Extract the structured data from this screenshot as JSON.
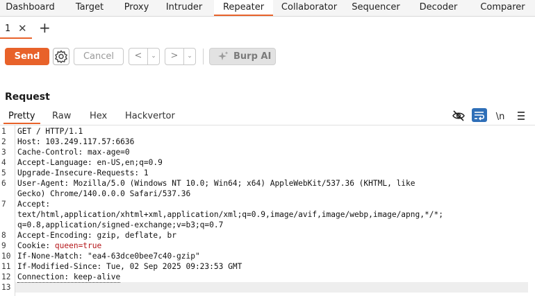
{
  "tool_tabs": [
    "Dashboard",
    "Target",
    "Proxy",
    "Intruder",
    "Repeater",
    "Collaborator",
    "Sequencer",
    "Decoder",
    "Comparer"
  ],
  "active_tool_tab": "Repeater",
  "sub_tab": {
    "label": "1",
    "close": "✕",
    "add": "+"
  },
  "toolbar": {
    "send": "Send",
    "cancel": "Cancel",
    "back": "<",
    "forward": ">",
    "dropdown": "⌄",
    "burp_ai": "Burp AI"
  },
  "request": {
    "title": "Request",
    "view_tabs": [
      "Pretty",
      "Raw",
      "Hex",
      "Hackvertor"
    ],
    "active_view": "Pretty",
    "newline_toggle": "\\n"
  },
  "colors": {
    "accent": "#e8622a",
    "wrap_icon_bg": "#2f6fb8",
    "cookie_value": "#b5161a"
  },
  "editor_lines": [
    {
      "n": "1",
      "text": "GET / HTTP/1.1"
    },
    {
      "n": "2",
      "text": "Host: 103.249.117.57:6636"
    },
    {
      "n": "3",
      "text": "Cache-Control: max-age=0"
    },
    {
      "n": "4",
      "text": "Accept-Language: en-US,en;q=0.9"
    },
    {
      "n": "5",
      "text": "Upgrade-Insecure-Requests: 1"
    },
    {
      "n": "6",
      "text": "User-Agent: Mozilla/5.0 (Windows NT 10.0; Win64; x64) AppleWebKit/537.36 (KHTML, like"
    },
    {
      "n": "",
      "text": "Gecko) Chrome/140.0.0.0 Safari/537.36"
    },
    {
      "n": "7",
      "text": "Accept:"
    },
    {
      "n": "",
      "text": "text/html,application/xhtml+xml,application/xml;q=0.9,image/avif,image/webp,image/apng,*/*;"
    },
    {
      "n": "",
      "text": "q=0.8,application/signed-exchange;v=b3;q=0.7"
    },
    {
      "n": "8",
      "text": "Accept-Encoding: gzip, deflate, br"
    },
    {
      "n": "9",
      "text": "Cookie: ",
      "cookie_value": "queen=true"
    },
    {
      "n": "10",
      "text": "If-None-Match: \"ea4-63dce0bee7c40-gzip\""
    },
    {
      "n": "11",
      "text": "If-Modified-Since: Tue, 02 Sep 2025 09:23:53 GMT"
    },
    {
      "n": "12",
      "text": "Connection: keep-alive"
    },
    {
      "n": "13",
      "text": ""
    }
  ]
}
